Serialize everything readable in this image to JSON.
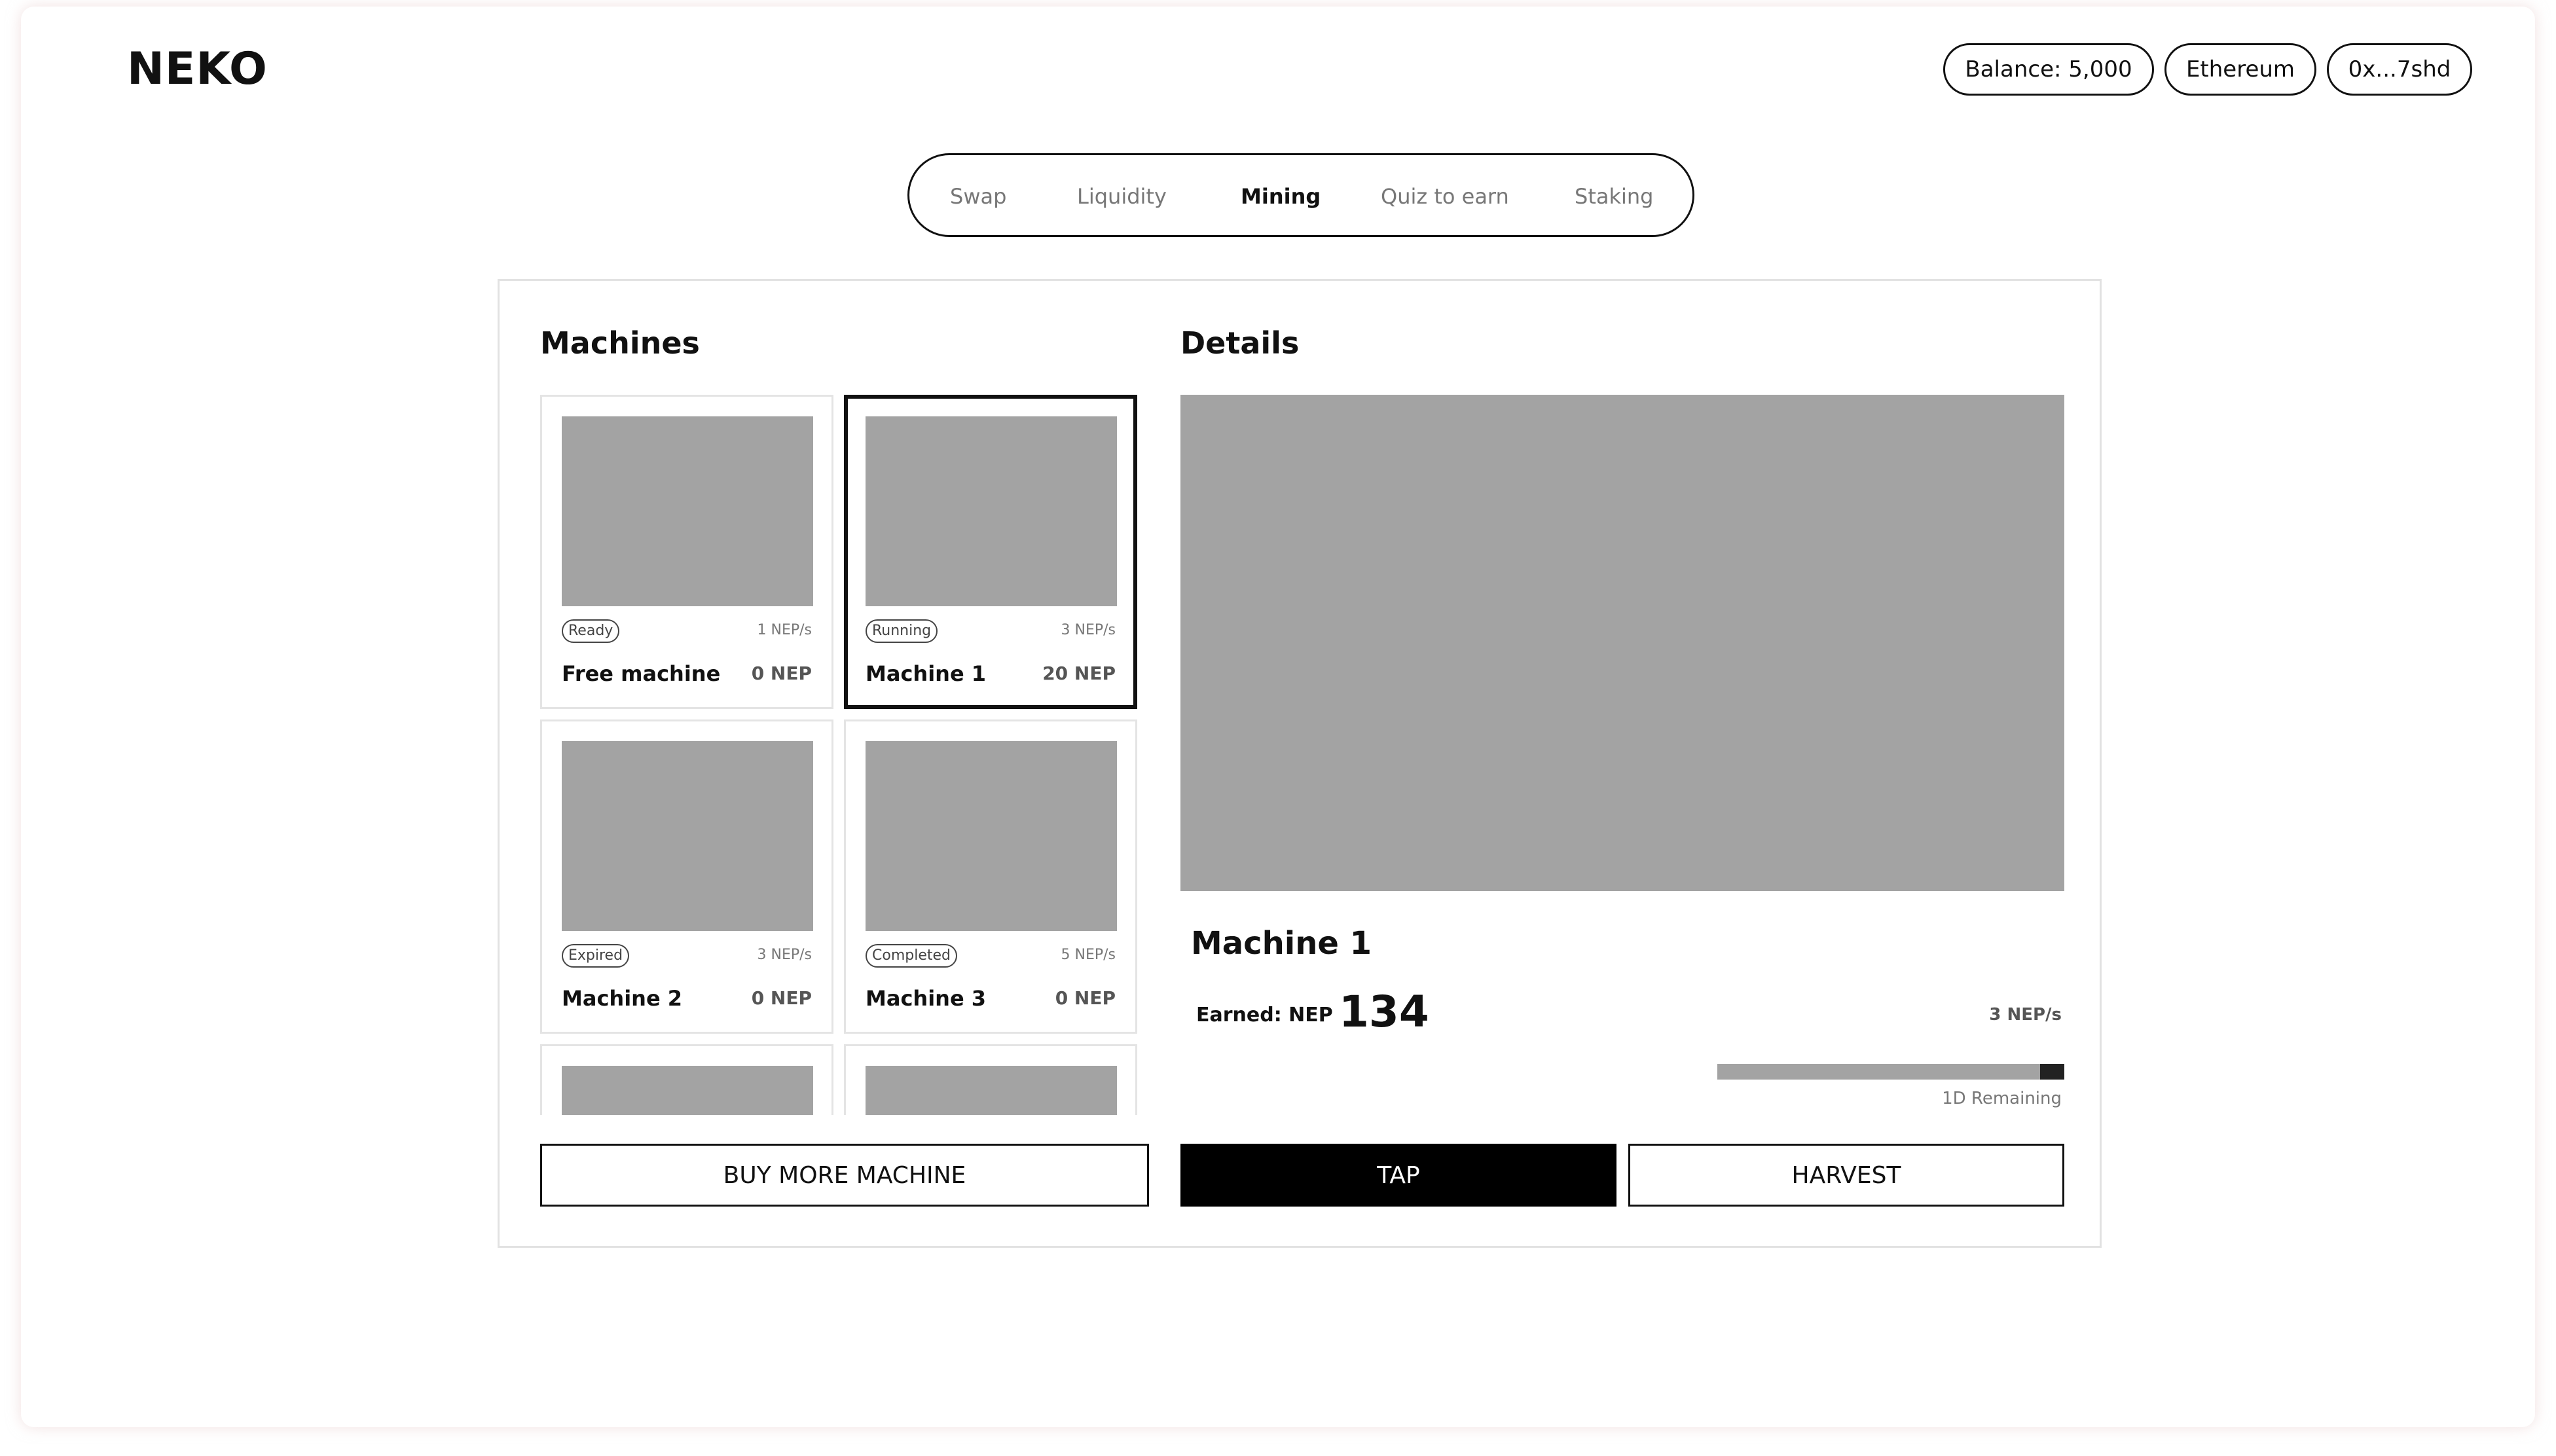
{
  "header": {
    "logo": "NEKO",
    "balance": "Balance: 5,000",
    "network": "Ethereum",
    "wallet": "0x...7shd"
  },
  "nav": {
    "items": [
      {
        "label": "Swap"
      },
      {
        "label": "Liquidity"
      },
      {
        "label": "Mining"
      },
      {
        "label": "Quiz to earn"
      },
      {
        "label": "Staking"
      }
    ],
    "active": "Mining"
  },
  "machines": {
    "title": "Machines",
    "items": [
      {
        "status": "Ready",
        "rate": "1 NEP/s",
        "name": "Free machine",
        "earned": "0 NEP"
      },
      {
        "status": "Running",
        "rate": "3 NEP/s",
        "name": "Machine 1",
        "earned": "20 NEP",
        "selected": true
      },
      {
        "status": "Expired",
        "rate": "3 NEP/s",
        "name": "Machine 2",
        "earned": "0 NEP"
      },
      {
        "status": "Completed",
        "rate": "5 NEP/s",
        "name": "Machine 3",
        "earned": "0 NEP"
      }
    ],
    "buy_label": "BUY MORE MACHINE"
  },
  "details": {
    "title": "Details",
    "name": "Machine 1",
    "earned_label": "Earned: NEP",
    "earned_value": "134",
    "rate": "3 NEP/s",
    "progress_remaining_fraction": 0.07,
    "remaining": "1D Remaining",
    "tap_label": "TAP",
    "harvest_label": "HARVEST"
  },
  "colors": {
    "placeholder": "#a3a3a3",
    "accent": "#000000",
    "border": "#e2e2e2"
  }
}
